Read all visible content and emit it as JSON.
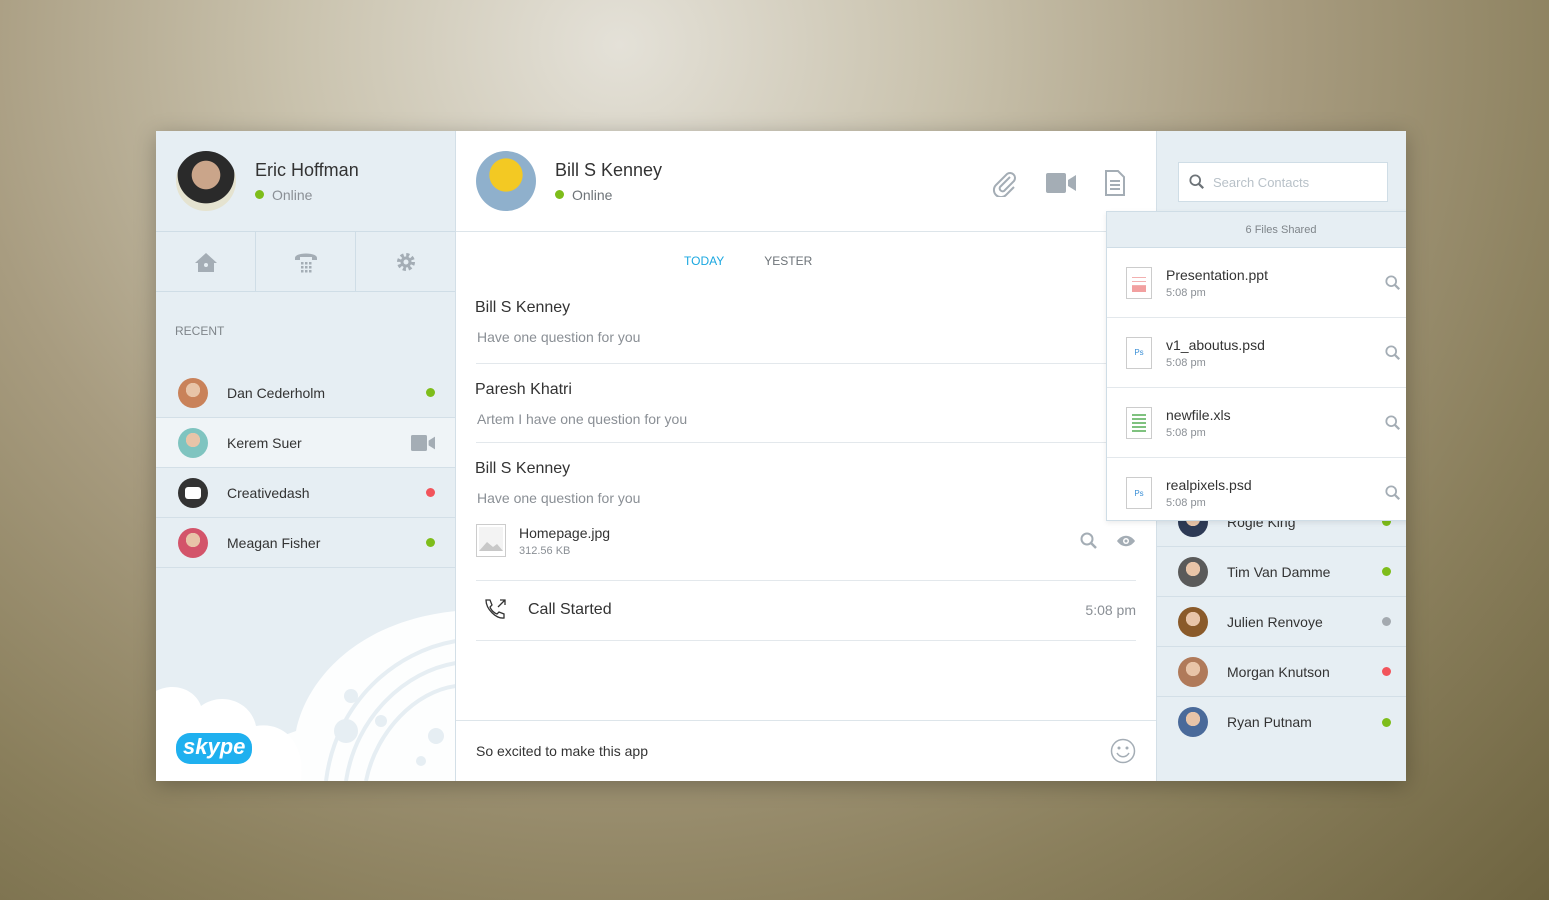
{
  "colors": {
    "online": "#7ebd1a",
    "offline": "#a4aab0",
    "busy": "#f2545b",
    "accent": "#1aa7e0",
    "skype": "#1fb0ef"
  },
  "me": {
    "name": "Eric Hoffman",
    "status": "Online"
  },
  "nav": [
    "home-icon",
    "dialpad-icon",
    "gear-icon"
  ],
  "recent": {
    "label": "RECENT",
    "items": [
      {
        "name": "Dan Cederholm",
        "status": "online",
        "avatar": "#c9825a"
      },
      {
        "name": "Kerem Suer",
        "status": "video",
        "avatar": "#7fc4c0"
      },
      {
        "name": "Creativedash",
        "status": "busy",
        "avatar": "#333333"
      },
      {
        "name": "Meagan Fisher",
        "status": "online",
        "avatar": "#d3546a"
      }
    ]
  },
  "logo": "skype",
  "chat": {
    "name": "Bill S Kenney",
    "status": "Online",
    "tabs": [
      "TODAY",
      "YESTER"
    ],
    "messages": [
      {
        "who": "Bill S Kenney",
        "text": "Have one question for you"
      },
      {
        "who": "Paresh Khatri",
        "text": "Artem I have one question for you"
      },
      {
        "who": "Bill S Kenney",
        "text": "Have one question for you"
      }
    ],
    "attachment": {
      "name": "Homepage.jpg",
      "size": "312.56 KB"
    },
    "call": {
      "label": "Call Started",
      "time": "5:08 pm"
    },
    "input": "So excited to make this app"
  },
  "files": {
    "title": "6 Files Shared",
    "items": [
      {
        "name": "Presentation.ppt",
        "time": "5:08 pm",
        "type": "ppt"
      },
      {
        "name": "v1_aboutus.psd",
        "time": "5:08 pm",
        "type": "psd"
      },
      {
        "name": "newfile.xls",
        "time": "5:08 pm",
        "type": "xls"
      },
      {
        "name": "realpixels.psd",
        "time": "5:08 pm",
        "type": "psd"
      }
    ]
  },
  "search": {
    "placeholder": "Search Contacts"
  },
  "contacts": [
    {
      "name": "Dan Cederholm",
      "status": "online",
      "avatar": "#c9825a"
    },
    {
      "name": "Kerem Suer",
      "status": "offline",
      "avatar": "#7fc4c0"
    },
    {
      "name": "Creativedash",
      "status": "busy",
      "avatar": "#333333"
    },
    {
      "name": "Meagan Fisher",
      "status": "online",
      "avatar": "#d3546a"
    },
    {
      "name": "Rogie King",
      "status": "online",
      "avatar": "#2d3a55"
    },
    {
      "name": "Tim Van Damme",
      "status": "online",
      "avatar": "#5a5a5a"
    },
    {
      "name": "Julien Renvoye",
      "status": "offline",
      "avatar": "#8a5a2a"
    },
    {
      "name": "Morgan Knutson",
      "status": "busy",
      "avatar": "#b07a5a"
    },
    {
      "name": "Ryan Putnam",
      "status": "online",
      "avatar": "#4a6a9a"
    }
  ]
}
